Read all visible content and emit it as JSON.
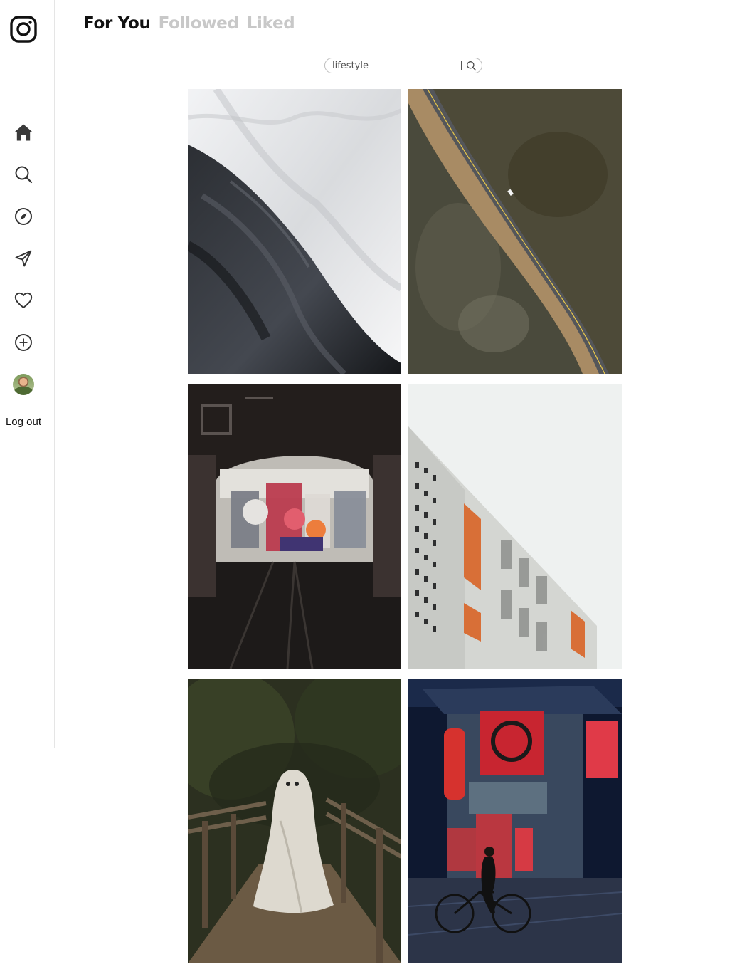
{
  "tabs": [
    {
      "label": "For You",
      "active": true
    },
    {
      "label": "Followed",
      "active": false
    },
    {
      "label": "Liked",
      "active": false
    }
  ],
  "search": {
    "value": "lifestyle"
  },
  "sidebar": {
    "items": [
      {
        "name": "home",
        "icon": "home-icon"
      },
      {
        "name": "search",
        "icon": "search-icon"
      },
      {
        "name": "explore",
        "icon": "compass-icon"
      },
      {
        "name": "messages",
        "icon": "send-icon"
      },
      {
        "name": "notifications",
        "icon": "heart-icon"
      },
      {
        "name": "create",
        "icon": "plus-circle-icon"
      },
      {
        "name": "profile",
        "icon": "avatar"
      }
    ],
    "logout_label": "Log out"
  },
  "feed": {
    "photos": [
      {
        "subject": "white and black fabric folds",
        "icon": "fabric-photo"
      },
      {
        "subject": "aerial view of road through marsh",
        "icon": "aerial-road-photo"
      },
      {
        "subject": "graffiti tunnel",
        "icon": "graffiti-tunnel-photo"
      },
      {
        "subject": "white building with orange balconies",
        "icon": "building-photo"
      },
      {
        "subject": "ghost costume on forest bridge",
        "icon": "ghost-photo"
      },
      {
        "subject": "neon street at night with cyclist",
        "icon": "neon-street-photo"
      }
    ]
  },
  "colors": {
    "accent": "#111111",
    "inactive_tab": "#c8c8c8",
    "border": "#e5e5e5"
  }
}
